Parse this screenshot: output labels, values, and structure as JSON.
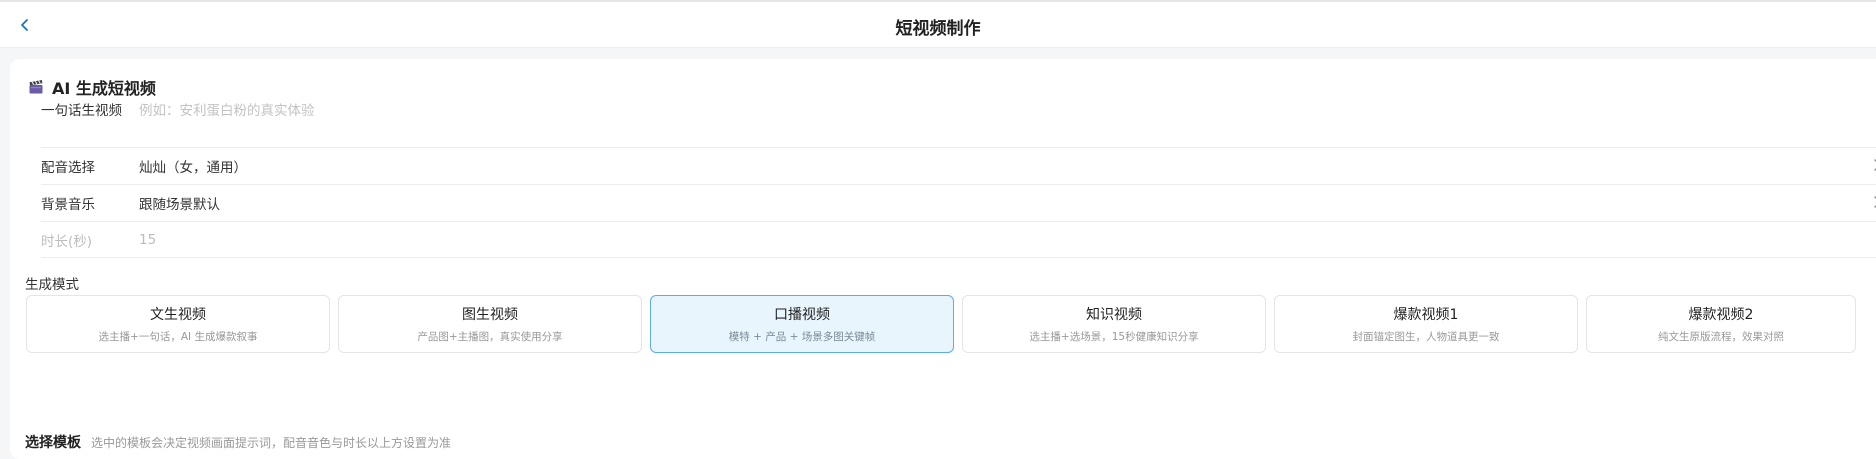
{
  "navbar": {
    "title": "短视频制作",
    "back_icon": "chevron-left-icon",
    "accent_color": "#1a73c9"
  },
  "card": {
    "icon": "clapperboard-icon",
    "title": "AI 生成短视频"
  },
  "prompt": {
    "label": "一句话生视频",
    "placeholder": "例如：安利蛋白粉的真实体验"
  },
  "voice": {
    "label": "配音选择",
    "value": "灿灿（女，通用）"
  },
  "music": {
    "label": "背景音乐",
    "value": "跟随场景默认"
  },
  "duration": {
    "label": "时长(秒)",
    "value": "15"
  },
  "modes_section": {
    "label": "生成模式",
    "active_index": 2,
    "items": [
      {
        "title": "文生视频",
        "desc": "选主播+一句话，AI 生成爆款叙事"
      },
      {
        "title": "图生视频",
        "desc": "产品图+主播图，真实使用分享"
      },
      {
        "title": "口播视频",
        "desc": "模特 + 产品 + 场景多图关键帧"
      },
      {
        "title": "知识视频",
        "desc": "选主播+选场景，15秒健康知识分享"
      },
      {
        "title": "爆款视频1",
        "desc": "封面锚定图生，人物道具更一致"
      },
      {
        "title": "爆款视频2",
        "desc": "纯文生原版流程，效果对照"
      }
    ]
  },
  "template_section": {
    "title": "选择模板",
    "hint": "选中的模板会决定视频画面提示词，配音音色与时长以上方设置为准"
  }
}
